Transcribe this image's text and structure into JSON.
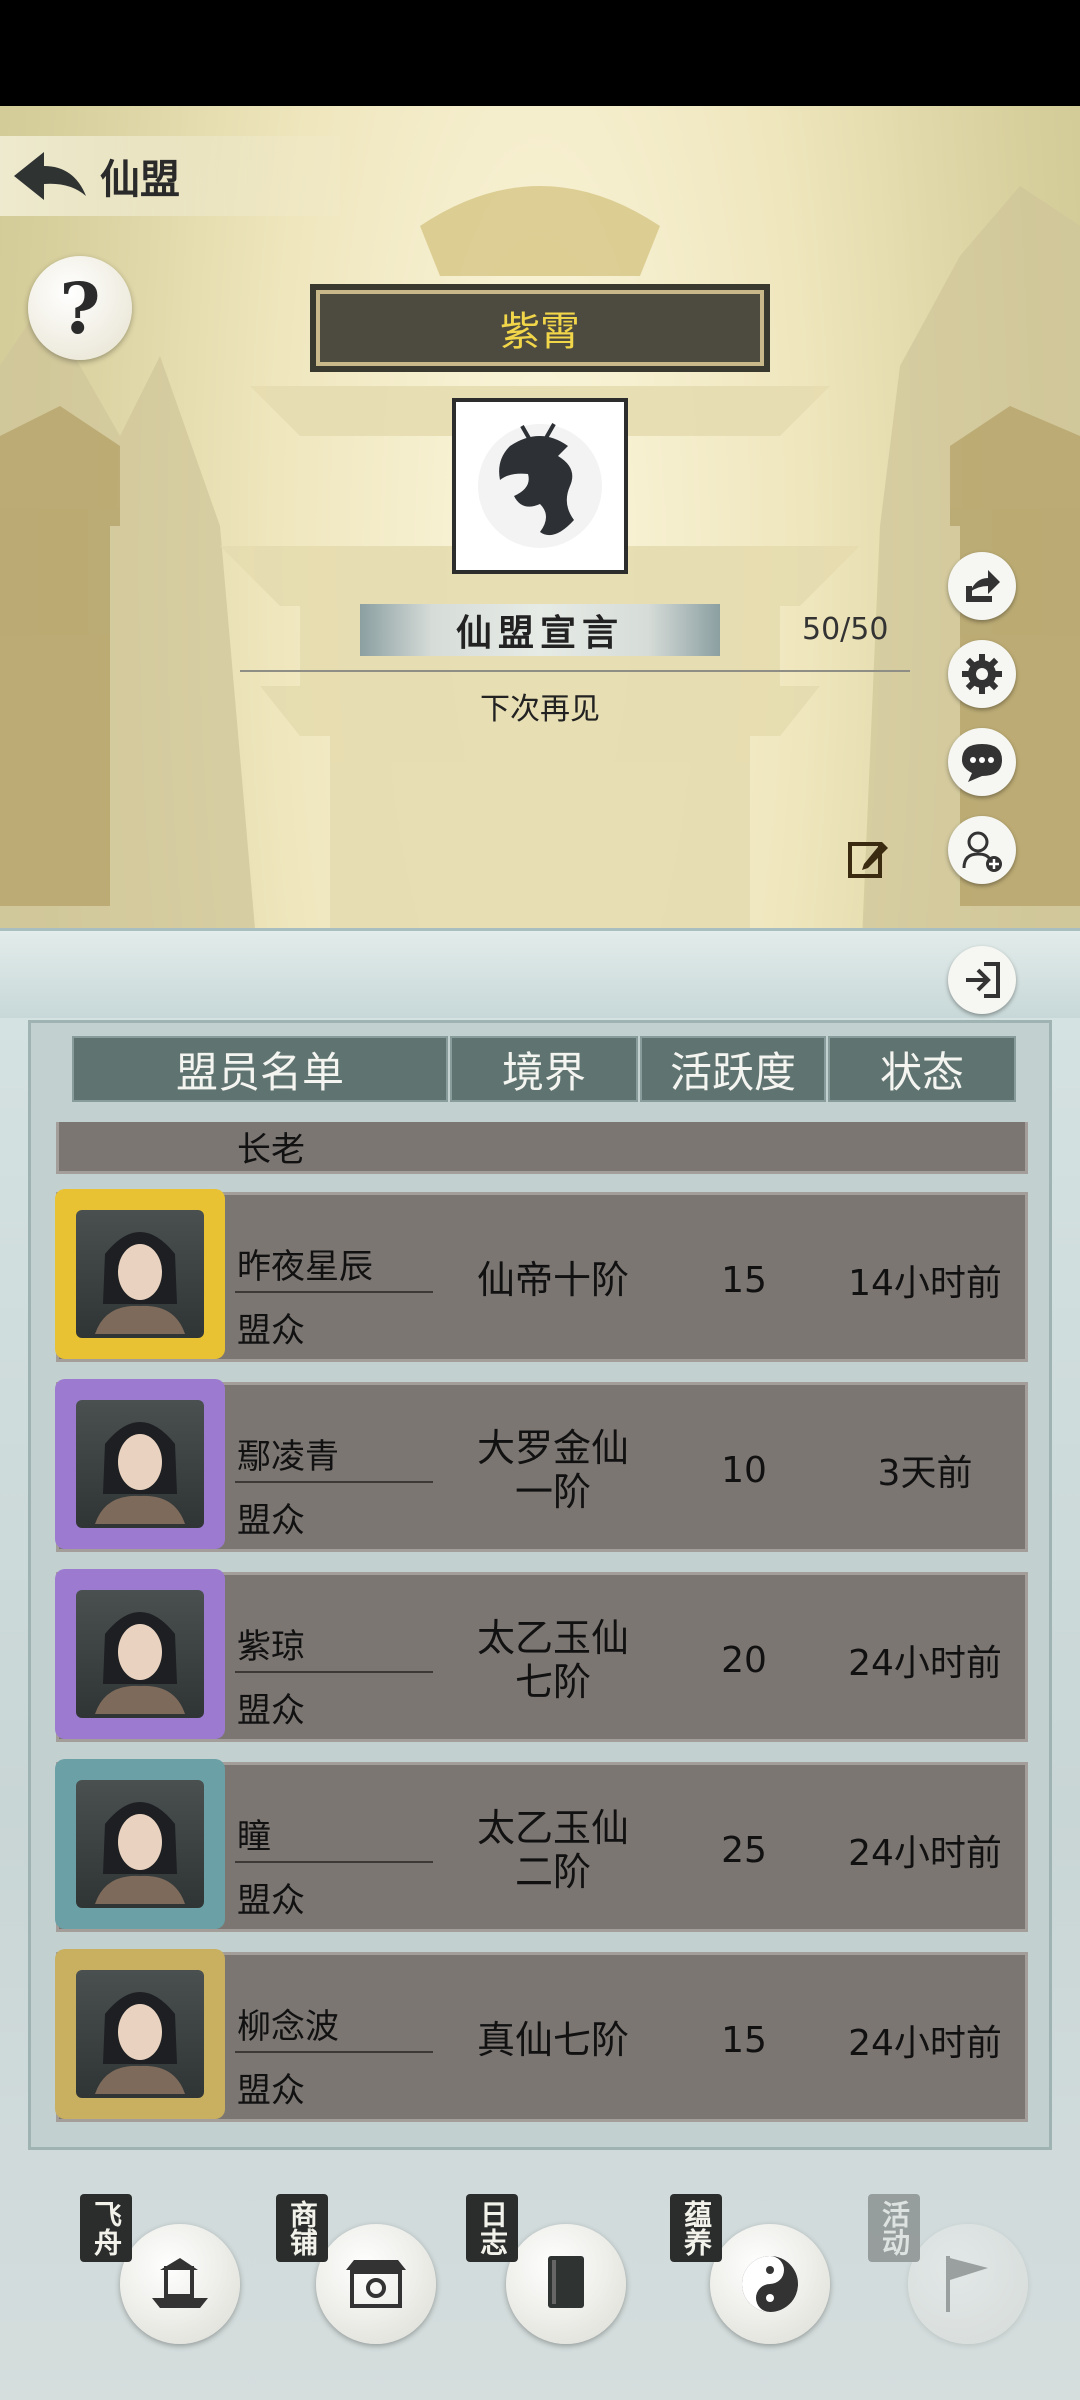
{
  "header": {
    "title": "仙盟",
    "help_glyph": "?"
  },
  "alliance": {
    "name": "紫霄",
    "declaration_label": "仙盟宣言",
    "member_count": "50/50",
    "declaration_text": "下次再见"
  },
  "table": {
    "columns": [
      "盟员名单",
      "境界",
      "活跃度",
      "状态"
    ],
    "partial_row_rank": "长老",
    "rows": [
      {
        "name": "昨夜星辰",
        "rank": "盟众",
        "realm": "仙帝十阶",
        "activity": "15",
        "status": "14小时前",
        "frame": "#e8c232"
      },
      {
        "name": "鄢凌青",
        "rank": "盟众",
        "realm": "大罗金仙\n一阶",
        "activity": "10",
        "status": "3天前",
        "frame": "#9c7ad0"
      },
      {
        "name": "紫琼",
        "rank": "盟众",
        "realm": "太乙玉仙\n七阶",
        "activity": "20",
        "status": "24小时前",
        "frame": "#9c7ad0"
      },
      {
        "name": "瞳",
        "rank": "盟众",
        "realm": "太乙玉仙\n二阶",
        "activity": "25",
        "status": "24小时前",
        "frame": "#6aa0a6"
      },
      {
        "name": "柳念波",
        "rank": "盟众",
        "realm": "真仙七阶",
        "activity": "15",
        "status": "24小时前",
        "frame": "#c8b060"
      }
    ]
  },
  "nav": [
    {
      "label": "飞舟",
      "icon": "boat-icon"
    },
    {
      "label": "商铺",
      "icon": "shop-icon"
    },
    {
      "label": "日志",
      "icon": "book-icon"
    },
    {
      "label": "蕴养",
      "icon": "taiji-icon"
    },
    {
      "label": "活动",
      "icon": "flag-icon"
    }
  ],
  "colors": {
    "banner_text": "#f2d64a",
    "row_bg": "#7c7673",
    "header_bg": "#5f7371"
  }
}
